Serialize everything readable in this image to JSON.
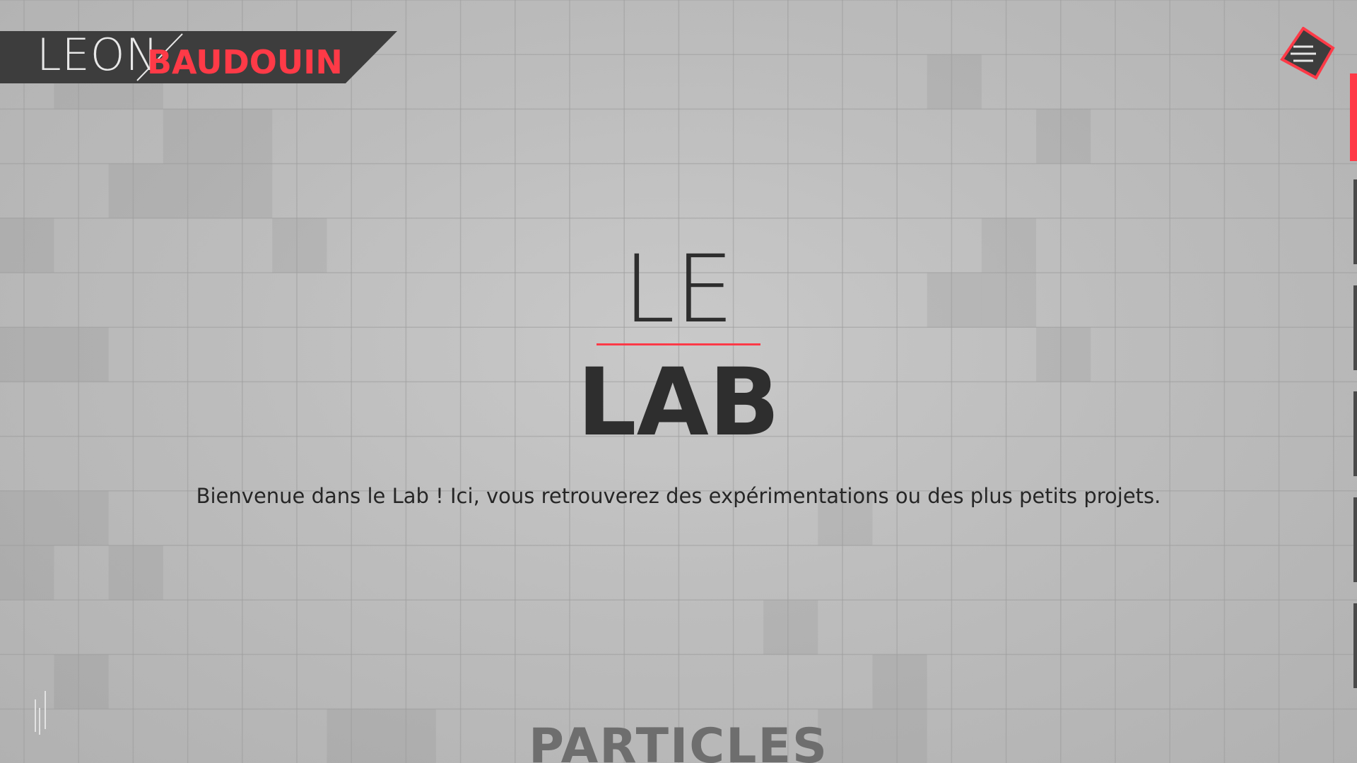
{
  "logo": {
    "first_name": "LEON",
    "last_name": "BAUDOUIN"
  },
  "menu": {
    "icon": "hamburger-icon"
  },
  "hero": {
    "title_top": "LE",
    "title_bottom": "LAB",
    "intro": "Bienvenue dans le Lab ! Ici, vous retrouverez des expérimentations ou des plus petits projets."
  },
  "section": {
    "title": "PARTICLES"
  },
  "nav": {
    "sections_count": 6,
    "active_index": 0
  },
  "audio": {
    "icon": "sound-bars-icon"
  },
  "colors": {
    "accent": "#ff3a47",
    "dark": "#3d3d3d",
    "text": "#2e2e2e",
    "background": "#bdbdbd",
    "grid_line": "#9c9c9c"
  }
}
